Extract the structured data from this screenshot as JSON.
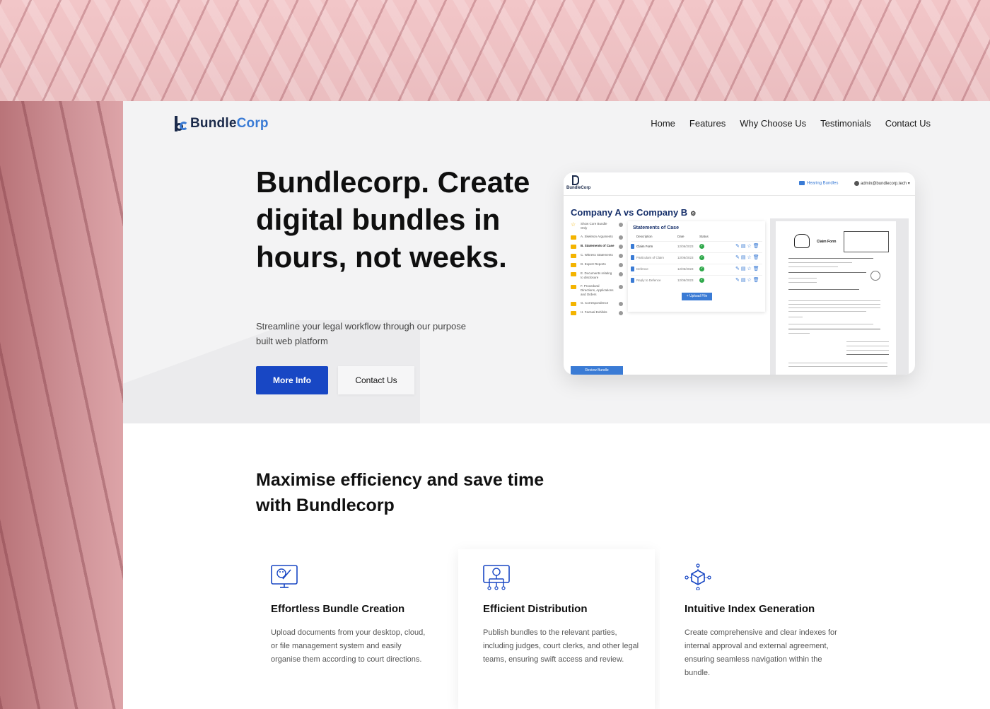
{
  "brand": {
    "name_part1": "Bundle",
    "name_part2": "Corp"
  },
  "nav": [
    "Home",
    "Features",
    "Why Choose Us",
    "Testimonials",
    "Contact Us"
  ],
  "hero": {
    "title": "Bundlecorp. Create digital bundles in hours, not weeks.",
    "subtitle": "Streamline your legal workflow through our purpose built web platform",
    "primary_button": "More Info",
    "secondary_button": "Contact Us"
  },
  "mockup": {
    "logo_text": "BundleCorp",
    "hearing_bundles": "Hearing Bundles",
    "user": "admin@bundlecorp.tech",
    "case_title": "Company A vs Company B",
    "sidebar": [
      {
        "label": "Show Core Bundle Only",
        "icon": "star-icon"
      },
      {
        "label": "A. Skeleton Arguments",
        "icon": "folder-icon"
      },
      {
        "label": "B. Statements of Case",
        "icon": "folder-icon",
        "active": true
      },
      {
        "label": "C. Witness Statements",
        "icon": "folder-icon"
      },
      {
        "label": "D. Expert Reports",
        "icon": "folder-icon"
      },
      {
        "label": "E. Documents relating to disclosure",
        "icon": "folder-icon"
      },
      {
        "label": "F. Procedural Directions, Applications and Orders",
        "icon": "folder-icon"
      },
      {
        "label": "G. Correspondence",
        "icon": "folder-icon"
      },
      {
        "label": "H. Factual Exhibits",
        "icon": "folder-icon"
      }
    ],
    "review_button": "Review Bundle",
    "panel_title": "Statements of Case",
    "columns": [
      "Description",
      "Date",
      "Status"
    ],
    "rows": [
      {
        "description": "Claim Form",
        "date": "12/06/2023"
      },
      {
        "description": "Particulars of Claim",
        "date": "12/06/2023"
      },
      {
        "description": "Defence",
        "date": "12/06/2023"
      },
      {
        "description": "Reply to Defence",
        "date": "12/06/2023"
      }
    ],
    "upload_button": "+ Upload File",
    "document_heading": "Claim Form"
  },
  "features": {
    "title": "Maximise efficiency and save time with Bundlecorp",
    "cards": [
      {
        "icon": "bundle-creation-icon",
        "title": "Effortless Bundle Creation",
        "text": "Upload documents from your desktop, cloud, or file management system and easily organise them according to court directions."
      },
      {
        "icon": "distribution-icon",
        "title": "Efficient Distribution",
        "text": "Publish bundles to the relevant parties, including judges, court clerks, and other legal teams, ensuring swift access and review."
      },
      {
        "icon": "index-generation-icon",
        "title": "Intuitive Index Generation",
        "text": "Create comprehensive and clear indexes for internal approval and external agreement, ensuring seamless navigation within the bundle."
      }
    ]
  },
  "colors": {
    "primary": "#1847c4",
    "accent": "#3a7bd5",
    "navy": "#17306b"
  }
}
